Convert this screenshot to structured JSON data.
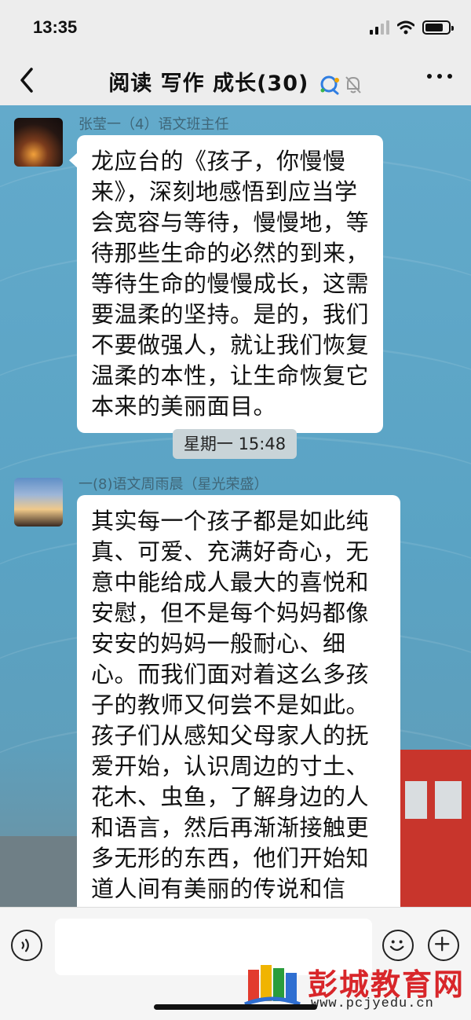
{
  "status_bar": {
    "time": "13:35"
  },
  "header": {
    "title": "阅读 写作 成长(30)"
  },
  "messages": [
    {
      "sender": "张莹一（4）语文班主任",
      "text": "龙应台的《孩子，你慢慢来》，深刻地感悟到应当学会宽容与等待，慢慢地，等待那些生命的必然的到来，等待生命的慢慢成长，这需要温柔的坚持。是的，我们不要做强人，就让我们恢复温柔的本性，让生命恢复它本来的美丽面目。"
    },
    {
      "sender": "一(8)语文周雨晨（星光荣盛）",
      "text": "其实每一个孩子都是如此纯真、可爱、充满好奇心，无意中能给成人最大的喜悦和安慰，但不是每个妈妈都像安安的妈妈一般耐心、细心。而我们面对着这么多孩子的教师又何尝不是如此。孩子们从感知父母家人的抚爱开始，认识周边的寸土、花木、虫鱼，了解身边的人和语言，然后再渐渐接触更多无形的东西，他们开始知道人间有美丽的传说和信仰，也有残酷的战争和杀戮。这一条长长的细细的成长之路，一切"
    }
  ],
  "timestamp": "星期一 15:48",
  "input": {
    "value": ""
  },
  "watermark": {
    "text": "彭城教育网",
    "url": "www.pcjyedu.cn"
  },
  "icons": [
    "back-icon",
    "chat-bubble-icon",
    "mute-bell-icon",
    "more-icon",
    "voice-icon",
    "emoji-icon",
    "plus-icon"
  ]
}
